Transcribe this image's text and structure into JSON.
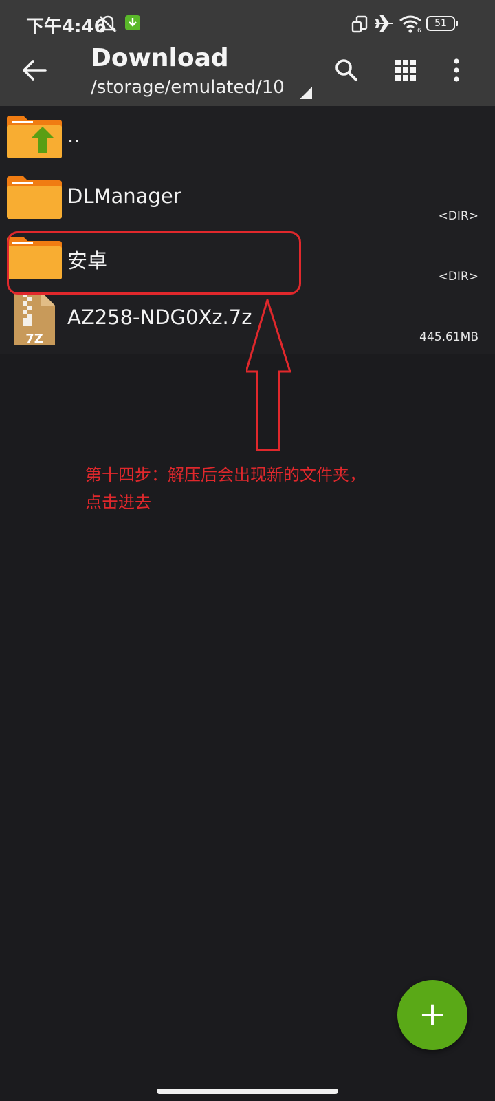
{
  "status_bar": {
    "time": "下午4:46",
    "battery": "51",
    "icons": [
      "mute-bell-icon",
      "download-notification-icon",
      "screen-rotation-icon",
      "airplane-icon",
      "wifi-icon",
      "battery-icon"
    ]
  },
  "app_bar": {
    "title": "Download",
    "path": "/storage/emulated/10",
    "icons": [
      "back-arrow-icon",
      "search-icon",
      "grid-view-icon",
      "more-vert-icon"
    ]
  },
  "files": [
    {
      "name": "..",
      "meta": "",
      "icon": "folder-up-icon"
    },
    {
      "name": "DLManager",
      "meta": "<DIR>",
      "icon": "folder-icon"
    },
    {
      "name": "安卓",
      "meta": "<DIR>",
      "icon": "folder-icon"
    },
    {
      "name": "AZ258-NDG0Xz.7z",
      "meta": "445.61MB",
      "icon": "archive-7z-icon"
    }
  ],
  "archive_label": "7Z",
  "annotation": {
    "line1": "第十四步：解压后会出现新的文件夹，",
    "line2": "点击进去"
  },
  "fab": {
    "label": "+"
  },
  "colors": {
    "bar_background": "#3a3a3a",
    "list_background": "#1f1f22",
    "folder": "#f5a623",
    "fab": "#5aa917",
    "annotation": "#e0282c"
  }
}
